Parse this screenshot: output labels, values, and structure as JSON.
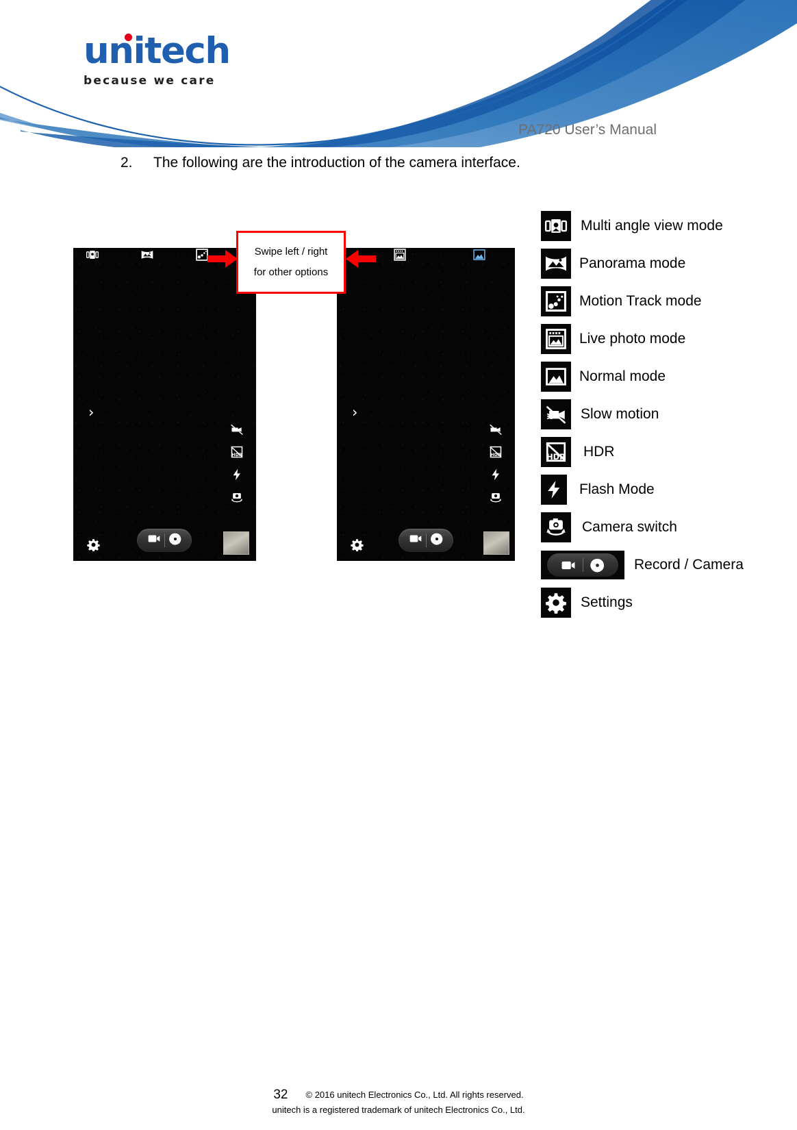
{
  "header": {
    "logo_word": "unitech",
    "logo_tagline": "because we care",
    "manual_title": "PA720 User’s Manual"
  },
  "body": {
    "step_number": "2.",
    "step_text": "The following are the introduction of the camera interface."
  },
  "callout": {
    "line1": "Swipe left / right",
    "line2": "for other options",
    "border_color": "#ff0000",
    "arrow_color": "#ff0000"
  },
  "screenshots": {
    "left": {
      "name": "camera-preview-left",
      "top_icons": [
        "multi-angle-view-icon",
        "panorama-icon",
        "motion-track-icon"
      ],
      "side_icons": [
        "slow-motion-off-icon",
        "hdr-off-icon",
        "flash-icon",
        "camera-switch-icon"
      ],
      "chevron": "›",
      "bottom_controls": [
        "record-icon",
        "shutter-icon"
      ],
      "gallery_thumbnail": "gallery-thumbnail",
      "settings_icon": "gear-icon"
    },
    "right": {
      "name": "camera-preview-right",
      "top_icons": [
        "live-photo-icon",
        "normal-mode-icon"
      ],
      "side_icons": [
        "slow-motion-off-icon",
        "hdr-off-icon",
        "flash-icon",
        "camera-switch-icon"
      ],
      "chevron": "›",
      "bottom_controls": [
        "record-icon",
        "shutter-icon"
      ],
      "gallery_thumbnail": "gallery-thumbnail",
      "settings_icon": "gear-icon"
    }
  },
  "legend": [
    {
      "icon": "multi-angle-view-icon",
      "label": "Multi angle view mode"
    },
    {
      "icon": "panorama-icon",
      "label": "Panorama mode"
    },
    {
      "icon": "motion-track-icon",
      "label": "Motion Track mode"
    },
    {
      "icon": "live-photo-icon",
      "label": "Live photo mode"
    },
    {
      "icon": "normal-mode-icon",
      "label": "Normal mode"
    },
    {
      "icon": "slow-motion-icon",
      "label": "Slow motion"
    },
    {
      "icon": "hdr-icon",
      "label": "HDR"
    },
    {
      "icon": "flash-icon",
      "label": "Flash Mode"
    },
    {
      "icon": "camera-switch-icon",
      "label": "Camera switch"
    },
    {
      "icon": "record-camera-icon",
      "label": "Record / Camera"
    },
    {
      "icon": "gear-icon",
      "label": "Settings"
    }
  ],
  "footer": {
    "page_number": "32",
    "copyright": "© 2016 unitech Electronics Co., Ltd. All rights reserved.",
    "trademark": "unitech is a registered trademark of unitech Electronics Co., Ltd."
  },
  "colors": {
    "brand_blue": "#1f5fae",
    "logo_dot_red": "#e2001a",
    "manual_title_gray": "#6d6e71",
    "callout_red": "#ff0000"
  }
}
